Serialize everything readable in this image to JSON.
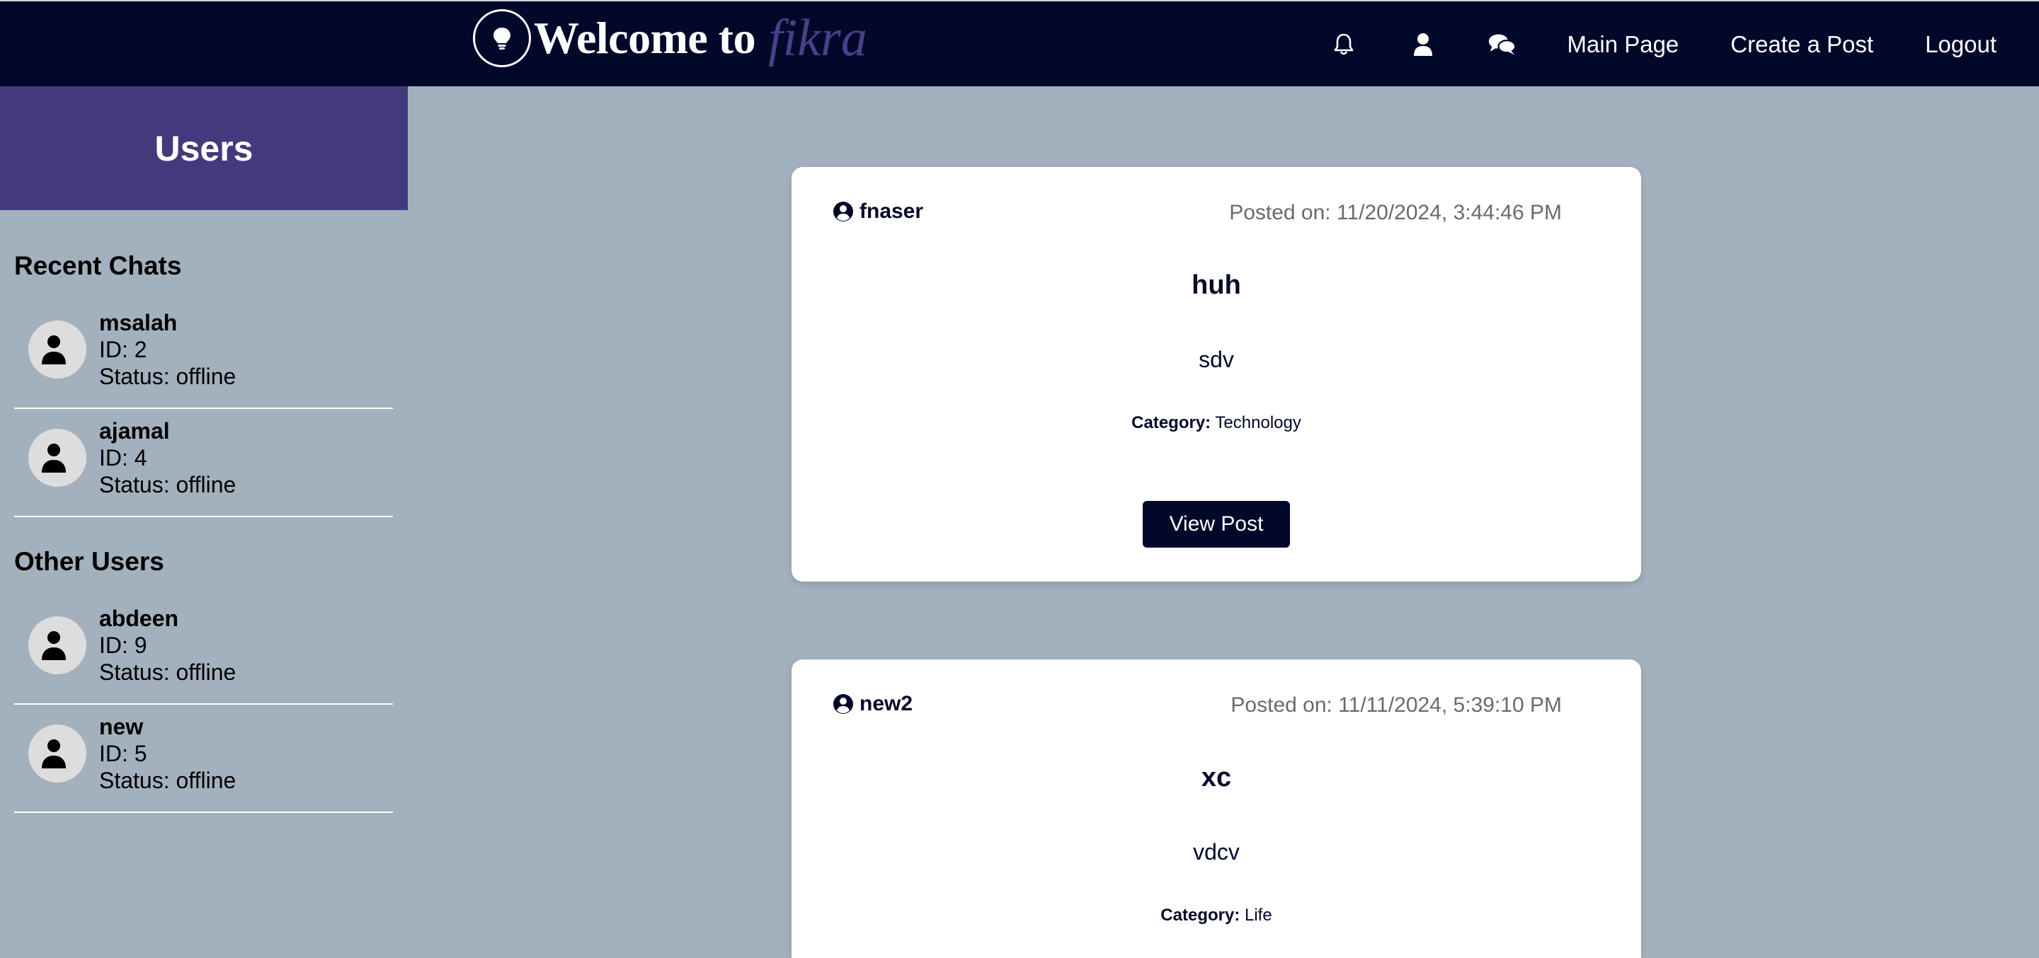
{
  "brand": {
    "title": "Welcome to",
    "accent": "fikra"
  },
  "nav": {
    "icons": [
      "bell-icon",
      "user-icon",
      "comments-icon"
    ],
    "main_page": "Main Page",
    "create_post": "Create a Post",
    "logout": "Logout"
  },
  "sidebar": {
    "title": "Users",
    "recent_title": "Recent Chats",
    "other_title": "Other Users",
    "recent": [
      {
        "name": "msalah",
        "id": "ID: 2",
        "status": "Status: offline"
      },
      {
        "name": "ajamal",
        "id": "ID: 4",
        "status": "Status: offline"
      }
    ],
    "other": [
      {
        "name": "abdeen",
        "id": "ID: 9",
        "status": "Status: offline"
      },
      {
        "name": "new",
        "id": "ID: 5",
        "status": "Status: offline"
      }
    ]
  },
  "posts": [
    {
      "author": "fnaser",
      "date": "Posted on: 11/20/2024, 3:44:46 PM",
      "title": "huh",
      "body": "sdv",
      "category_label": "Category:",
      "category": "Technology",
      "button": "View Post"
    },
    {
      "author": "new2",
      "date": "Posted on: 11/11/2024, 5:39:10 PM",
      "title": "xc",
      "body": "vdcv",
      "category_label": "Category:",
      "category": "Life"
    }
  ],
  "colors": {
    "navbar": "#02082a",
    "sidebar_header": "#433a7e",
    "background": "#a3b0bd",
    "accent": "#4a3f8a"
  }
}
